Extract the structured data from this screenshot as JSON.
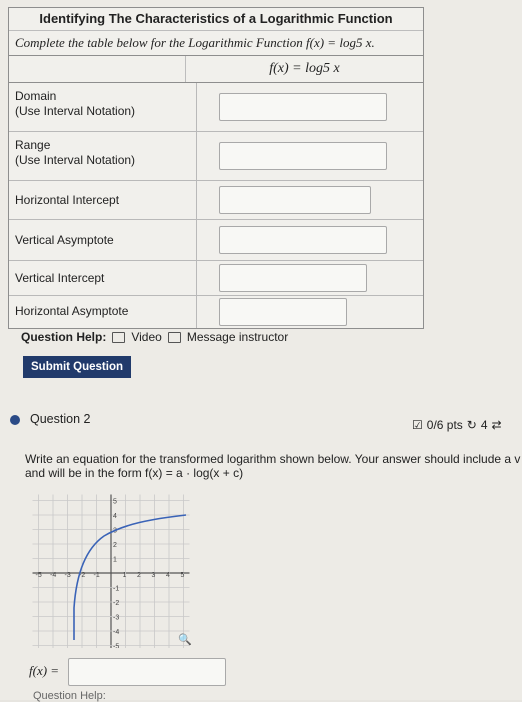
{
  "table": {
    "title": "Identifying The Characteristics of a Logarithmic Function",
    "subtitle": "Complete the table below for the Logarithmic Function f(x) = log5 x.",
    "column_header": "f(x) = log5 x",
    "rows": [
      {
        "label_line1": "Domain",
        "label_line2": "(Use Interval Notation)"
      },
      {
        "label_line1": "Range",
        "label_line2": "(Use Interval Notation)"
      },
      {
        "label_line1": "Horizontal Intercept",
        "label_line2": ""
      },
      {
        "label_line1": "Vertical Asymptote",
        "label_line2": ""
      },
      {
        "label_line1": "Vertical Intercept",
        "label_line2": ""
      },
      {
        "label_line1": "Horizontal Asymptote",
        "label_line2": ""
      }
    ]
  },
  "help": {
    "label": "Question Help:",
    "video": "Video",
    "message": "Message instructor"
  },
  "submit_label": "Submit Question",
  "question2": {
    "title": "Question 2",
    "points": "0/6 pts",
    "retries": "4",
    "prompt_line1": "Write an equation for the transformed logarithm shown below. Your answer should include a v",
    "prompt_line2": "and will be in the form f(x) = a · log(x + c)",
    "fx_label": "f(x) =",
    "bottom_help": "Question Help:"
  },
  "graph": {
    "x_ticks": [
      "-5",
      "-4",
      "-3",
      "-2",
      "-1",
      "1",
      "2",
      "3",
      "4",
      "5"
    ],
    "y_ticks": [
      "5",
      "4",
      "3",
      "2",
      "1",
      "-1",
      "-2",
      "-3",
      "-4",
      "-5"
    ]
  }
}
